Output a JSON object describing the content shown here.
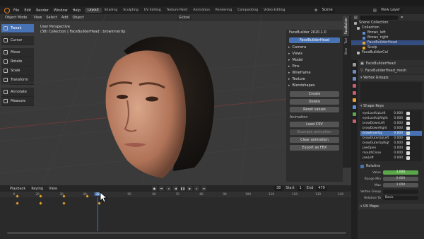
{
  "menu": [
    "File",
    "Edit",
    "Render",
    "Window",
    "Help"
  ],
  "workspaces": [
    {
      "label": "Layout",
      "active": true
    },
    {
      "label": "Shading"
    },
    {
      "label": "Sculpting"
    },
    {
      "label": "UV Editing"
    },
    {
      "label": "Texture Paint"
    },
    {
      "label": "Animation"
    },
    {
      "label": "Rendering"
    },
    {
      "label": "Compositing"
    },
    {
      "label": "Video Editing"
    }
  ],
  "scene": {
    "label": "Scene",
    "view_layer": "View Layer"
  },
  "viewport": {
    "mode": "Object Mode",
    "menus": [
      "View",
      "Select",
      "Add",
      "Object"
    ],
    "transform": "Global",
    "title_line1": "User Perspective",
    "title_line2": "(38) Collection | FaceBuilderHead : browInnerUp"
  },
  "toolbar": [
    "Tweak",
    "Cursor",
    "Move",
    "Rotate",
    "Scale",
    "Transform",
    "Annotate",
    "Measure"
  ],
  "facebuilder": {
    "title": "FaceBuilder 2020.1.0",
    "head_button": "FaceBuilderHead",
    "sections": [
      "Camera",
      "Views",
      "Model",
      "Pins",
      "Wireframe",
      "Texture",
      "Blendshapes"
    ],
    "buttons": [
      "Create",
      "Delete",
      "Reset values"
    ],
    "animation_label": "Animation",
    "anim_buttons": [
      "Load CSV",
      "Example animation",
      "Clear animation",
      "Export as FBX"
    ],
    "side_tabs": [
      "FaceBuilder",
      "Tool",
      "View"
    ]
  },
  "timeline": {
    "menus": [
      "Playback",
      "Keying",
      "View"
    ],
    "current_frame": "38",
    "start_label": "Start",
    "start": "1",
    "end_label": "End",
    "end": "479",
    "ruler": [
      "0",
      "20",
      "30",
      "40",
      "50",
      "60",
      "70",
      "80",
      "90",
      "100",
      "110",
      "120",
      "130",
      "140"
    ],
    "playhead_label": "38"
  },
  "outliner": {
    "root": "Scene Collection",
    "items": [
      {
        "label": "Collection",
        "level": 0,
        "color": "#bbbbbb"
      },
      {
        "label": "Brows_left",
        "level": 1,
        "color": "#5a8fd8"
      },
      {
        "label": "Brows_right",
        "level": 1,
        "color": "#5a8fd8"
      },
      {
        "label": "FaceBuilderHead",
        "level": 1,
        "color": "#e8a030",
        "selected": true
      },
      {
        "label": "Scalp",
        "level": 1,
        "color": "#e8a030"
      },
      {
        "label": "FaceBuilderCol",
        "level": 0,
        "color": "#bbbbbb"
      }
    ]
  },
  "properties": {
    "object": "FaceBuilderHead",
    "mesh": "FaceBuilderHead_mesh",
    "vertex_groups": "Vertex Groups",
    "shape_keys": "Shape Keys",
    "keys": [
      {
        "name": "eyeLookUpLeft",
        "value": "0.000"
      },
      {
        "name": "eyeLookUpRight",
        "value": "0.000"
      },
      {
        "name": "browDownLeft",
        "value": "0.000"
      },
      {
        "name": "browDownRight",
        "value": "0.000"
      },
      {
        "name": "browInnerUp",
        "value": "0.000",
        "selected": true
      },
      {
        "name": "browOuterUpLeft",
        "value": "0.000"
      },
      {
        "name": "browOuterUpRight",
        "value": "0.000"
      },
      {
        "name": "jawOpen",
        "value": "0.000"
      },
      {
        "name": "mouthClose",
        "value": "0.000"
      },
      {
        "name": "jawLeft",
        "value": "0.000"
      }
    ],
    "relative_label": "Relative",
    "value_label": "Value",
    "value": "1.000",
    "range_min_label": "Range Min",
    "range_min": "0.000",
    "max_label": "Max",
    "max": "1.000",
    "vertex_group_label": "Vertex Group",
    "relative_to_label": "Relative To",
    "relative_to": "Basis",
    "uv_maps": "UV Maps"
  },
  "colors": {
    "accent": "#4772b3",
    "keyframe": "#e3a12a",
    "value_green": "#5aa84a"
  }
}
